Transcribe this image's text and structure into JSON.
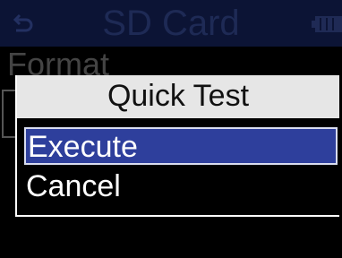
{
  "header": {
    "title": "SD Card",
    "back_icon": "back-arrow-icon",
    "battery_icon": "battery-icon"
  },
  "background_menu": {
    "item": "Format"
  },
  "dialog": {
    "title": "Quick Test",
    "options": [
      {
        "label": "Execute",
        "selected": true
      },
      {
        "label": "Cancel",
        "selected": false
      }
    ]
  },
  "colors": {
    "selection": "#2e3f9c",
    "dialog_title_bg": "#e6e6e6",
    "header_bg": "#0c1435"
  }
}
